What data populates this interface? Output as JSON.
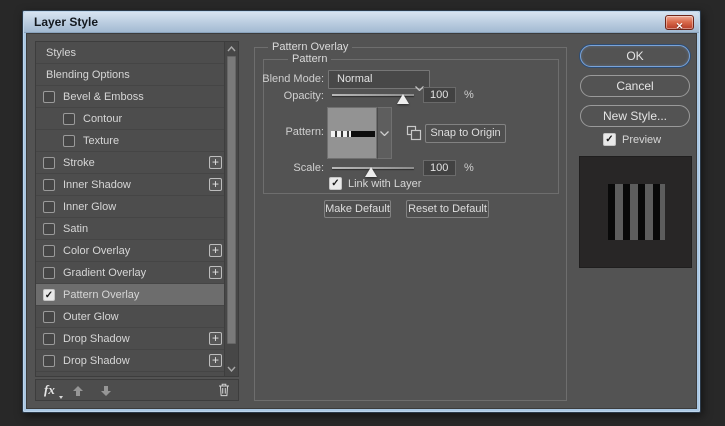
{
  "window": {
    "title": "Layer Style"
  },
  "icons": {
    "close": "✕",
    "check": "✓",
    "plus": "+"
  },
  "colors": {
    "frame_blue": "#aac8e4",
    "dialog_bg": "#535353",
    "sidebar_bg": "#4d4d4d",
    "selected_row": "#6d6d6d",
    "close_button_red": "#b63c27",
    "ok_ring_blue": "#7aa4d9",
    "text": "#d6d6d6"
  },
  "sidebar": {
    "items": [
      {
        "label": "Styles",
        "checkbox": null,
        "plus": false,
        "indent": false,
        "selected": false
      },
      {
        "label": "Blending Options",
        "checkbox": null,
        "plus": false,
        "indent": false,
        "selected": false
      },
      {
        "label": "Bevel & Emboss",
        "checkbox": false,
        "plus": false,
        "indent": false,
        "selected": false
      },
      {
        "label": "Contour",
        "checkbox": false,
        "plus": false,
        "indent": true,
        "selected": false
      },
      {
        "label": "Texture",
        "checkbox": false,
        "plus": false,
        "indent": true,
        "selected": false
      },
      {
        "label": "Stroke",
        "checkbox": false,
        "plus": true,
        "indent": false,
        "selected": false
      },
      {
        "label": "Inner Shadow",
        "checkbox": false,
        "plus": true,
        "indent": false,
        "selected": false
      },
      {
        "label": "Inner Glow",
        "checkbox": false,
        "plus": false,
        "indent": false,
        "selected": false
      },
      {
        "label": "Satin",
        "checkbox": false,
        "plus": false,
        "indent": false,
        "selected": false
      },
      {
        "label": "Color Overlay",
        "checkbox": false,
        "plus": true,
        "indent": false,
        "selected": false
      },
      {
        "label": "Gradient Overlay",
        "checkbox": false,
        "plus": true,
        "indent": false,
        "selected": false
      },
      {
        "label": "Pattern Overlay",
        "checkbox": true,
        "plus": false,
        "indent": false,
        "selected": true
      },
      {
        "label": "Outer Glow",
        "checkbox": false,
        "plus": false,
        "indent": false,
        "selected": false
      },
      {
        "label": "Drop Shadow",
        "checkbox": false,
        "plus": true,
        "indent": false,
        "selected": false
      },
      {
        "label": "Drop Shadow",
        "checkbox": false,
        "plus": true,
        "indent": false,
        "selected": false
      }
    ],
    "footer": {
      "fx_label": "fx"
    }
  },
  "panel": {
    "group_title": "Pattern Overlay",
    "sub_group_title": "Pattern",
    "blend_mode": {
      "label": "Blend Mode:",
      "value": "Normal"
    },
    "opacity": {
      "label": "Opacity:",
      "value": "100",
      "unit": "%"
    },
    "pattern": {
      "label": "Pattern:",
      "snap_button": "Snap to Origin"
    },
    "scale": {
      "label": "Scale:",
      "value": "100",
      "unit": "%"
    },
    "link_with_layer": {
      "label": "Link with Layer",
      "checked": true
    },
    "buttons": {
      "make_default": "Make Default",
      "reset_default": "Reset to Default"
    }
  },
  "actions": {
    "ok": "OK",
    "cancel": "Cancel",
    "new_style": "New Style...",
    "preview": {
      "label": "Preview",
      "checked": true
    }
  }
}
